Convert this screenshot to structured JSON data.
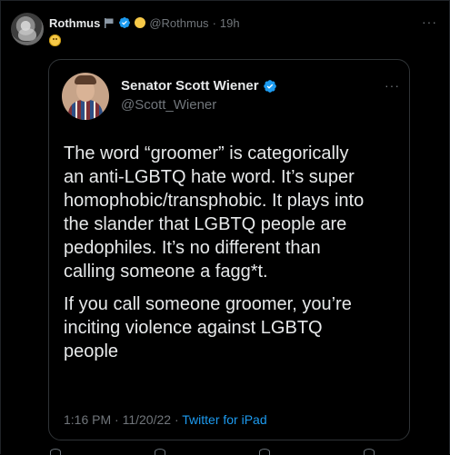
{
  "outer_post": {
    "display_name": "Rothmus",
    "handle": "@Rothmus",
    "separator": "·",
    "time_ago": "19h",
    "more_label": "···"
  },
  "quoted_post": {
    "display_name": "Senator Scott Wiener",
    "handle": "@Scott_Wiener",
    "more_label": "···",
    "paragraphs": [
      "The word “groomer” is categorically\nan anti-LGBTQ hate word. It’s super\nhomophobic/transphobic. It plays into\nthe slander that LGBTQ people are\npedophiles. It’s no different than\ncalling someone a fagg*t.",
      "If you call someone groomer, you’re\ninciting violence against LGBTQ\npeople"
    ],
    "time": "1:16 PM",
    "date": "11/20/22",
    "separator": "·",
    "source": "Twitter for iPad"
  },
  "colors": {
    "background": "#000000",
    "text_primary": "#e7e9ea",
    "text_secondary": "#71767b",
    "accent_blue": "#1d9bf0",
    "border": "#2f3336"
  }
}
